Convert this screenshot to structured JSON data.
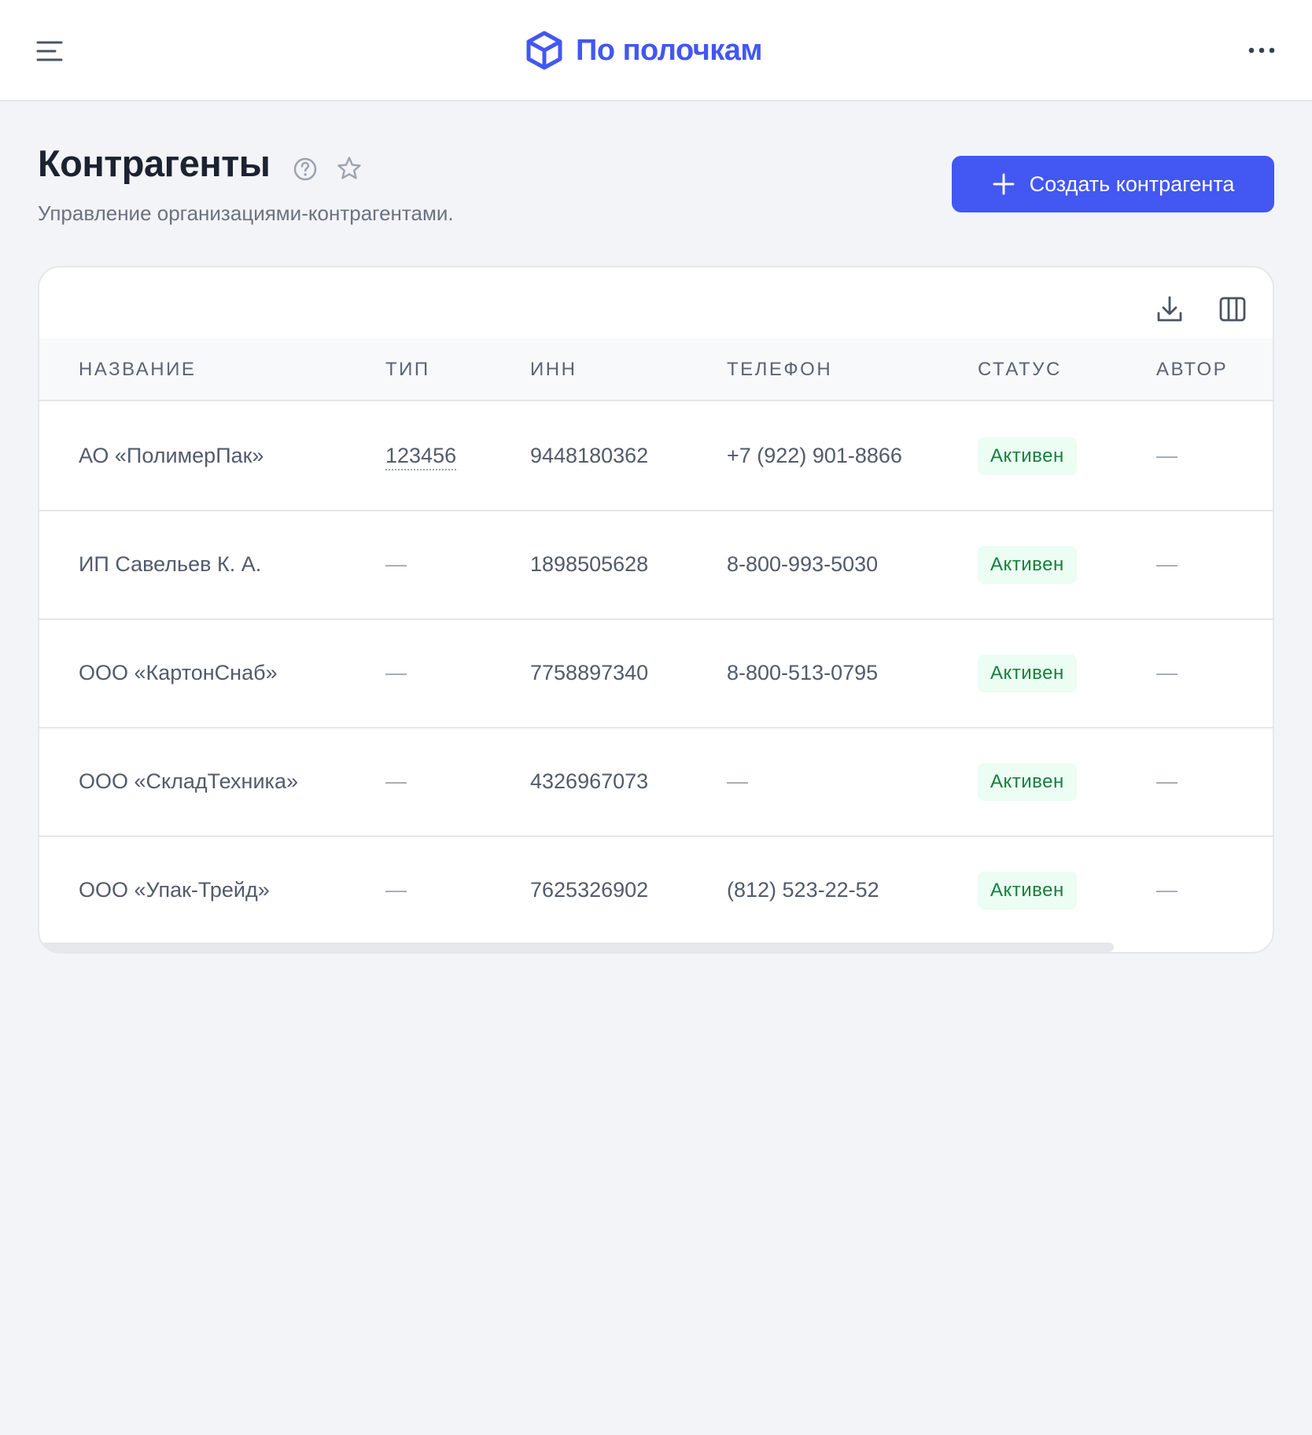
{
  "header": {
    "brand_name": "По полочкам"
  },
  "page": {
    "title": "Контрагенты",
    "subtitle": "Управление организациями-контрагентами.",
    "create_label": "Создать контрагента"
  },
  "table": {
    "columns": [
      "НАЗВАНИЕ",
      "ТИП",
      "ИНН",
      "ТЕЛЕФОН",
      "СТАТУС",
      "АВТОР"
    ],
    "rows": [
      {
        "name": "АО «ПолимерПак»",
        "type": "123456",
        "inn": "9448180362",
        "phone": "+7 (922) 901-8866",
        "status": "Активен",
        "author": "—"
      },
      {
        "name": "ИП Савельев К. А.",
        "type": "—",
        "inn": "1898505628",
        "phone": "8-800-993-5030",
        "status": "Активен",
        "author": "—"
      },
      {
        "name": "ООО «КартонСнаб»",
        "type": "—",
        "inn": "7758897340",
        "phone": "8-800-513-0795",
        "status": "Активен",
        "author": "—"
      },
      {
        "name": "ООО «СкладТехника»",
        "type": "—",
        "inn": "4326967073",
        "phone": "—",
        "status": "Активен",
        "author": "—"
      },
      {
        "name": "ООО «Упак-Трейд»",
        "type": "—",
        "inn": "7625326902",
        "phone": "(812) 523-22-52",
        "status": "Активен",
        "author": "—"
      }
    ]
  },
  "colors": {
    "accent": "#4357f2",
    "status_active_bg": "#ecfdf3",
    "status_active_text": "#15803d"
  },
  "icons": {
    "menu": "menu-icon",
    "brand": "box-logo-icon",
    "more": "more-dots-icon",
    "help": "help-circle-icon",
    "favorite": "star-icon",
    "create": "plus-icon",
    "export": "download-icon",
    "columns": "columns-icon"
  }
}
